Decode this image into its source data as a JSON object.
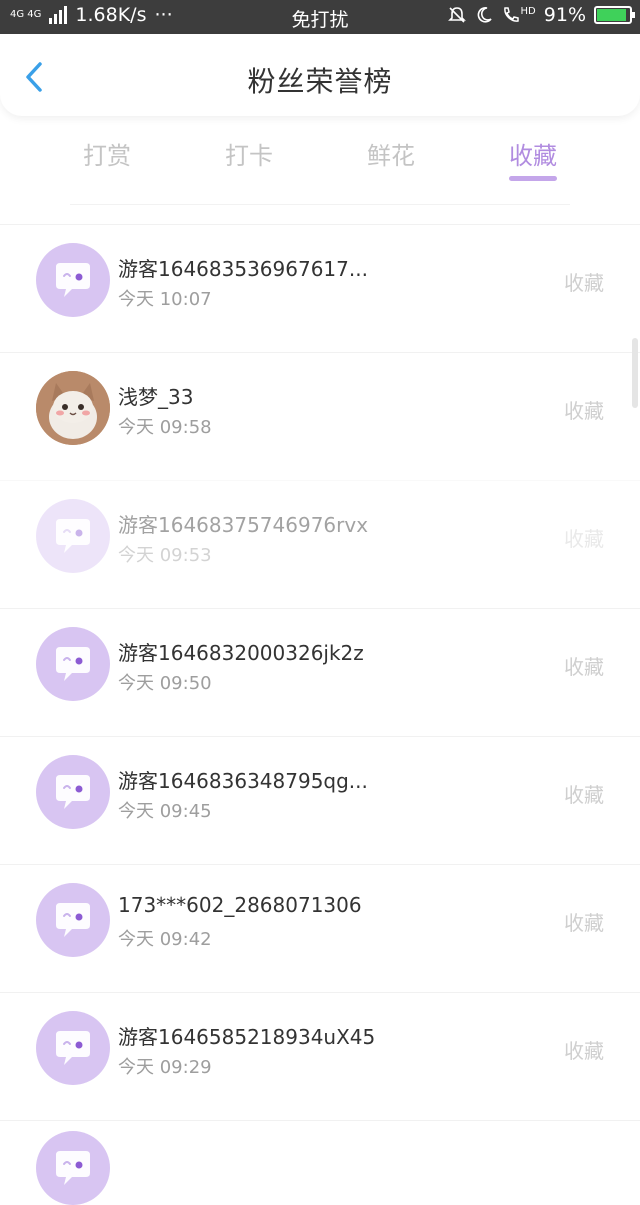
{
  "status_bar": {
    "network": "4G 4G",
    "speed": "1.68K/s",
    "more": "···",
    "center": "免打扰",
    "hd": "HD",
    "battery_percent": "91%",
    "battery_level": 0.91
  },
  "header": {
    "title": "粉丝荣誉榜"
  },
  "tabs": [
    {
      "label": "打赏",
      "active": false
    },
    {
      "label": "打卡",
      "active": false
    },
    {
      "label": "鲜花",
      "active": false
    },
    {
      "label": "收藏",
      "active": true
    }
  ],
  "colors": {
    "accent": "#b18ce0",
    "avatar_bg": "#d8c5f2",
    "statusbar": "#3d3d3d",
    "battery": "#3fd15a"
  },
  "fans": [
    {
      "name": "游客164683536967617...",
      "time": "今天 10:07",
      "action": "收藏",
      "avatar": "chat-bubble-icon"
    },
    {
      "name": "浅梦_33",
      "time": "今天 09:58",
      "action": "收藏",
      "avatar": "cat-photo"
    },
    {
      "name": "游客16468375746976rvx",
      "time": "今天 09:53",
      "action": "收藏",
      "avatar": "chat-bubble-icon"
    },
    {
      "name": "游客1646832000326jk2z",
      "time": "今天 09:50",
      "action": "收藏",
      "avatar": "chat-bubble-icon"
    },
    {
      "name": "游客1646836348795qg...",
      "time": "今天 09:45",
      "action": "收藏",
      "avatar": "chat-bubble-icon"
    },
    {
      "name": "173***602_2868071306",
      "time": "今天 09:42",
      "action": "收藏",
      "avatar": "chat-bubble-icon"
    },
    {
      "name": "游客1646585218934uX45",
      "time": "今天 09:29",
      "action": "收藏",
      "avatar": "chat-bubble-icon"
    }
  ]
}
